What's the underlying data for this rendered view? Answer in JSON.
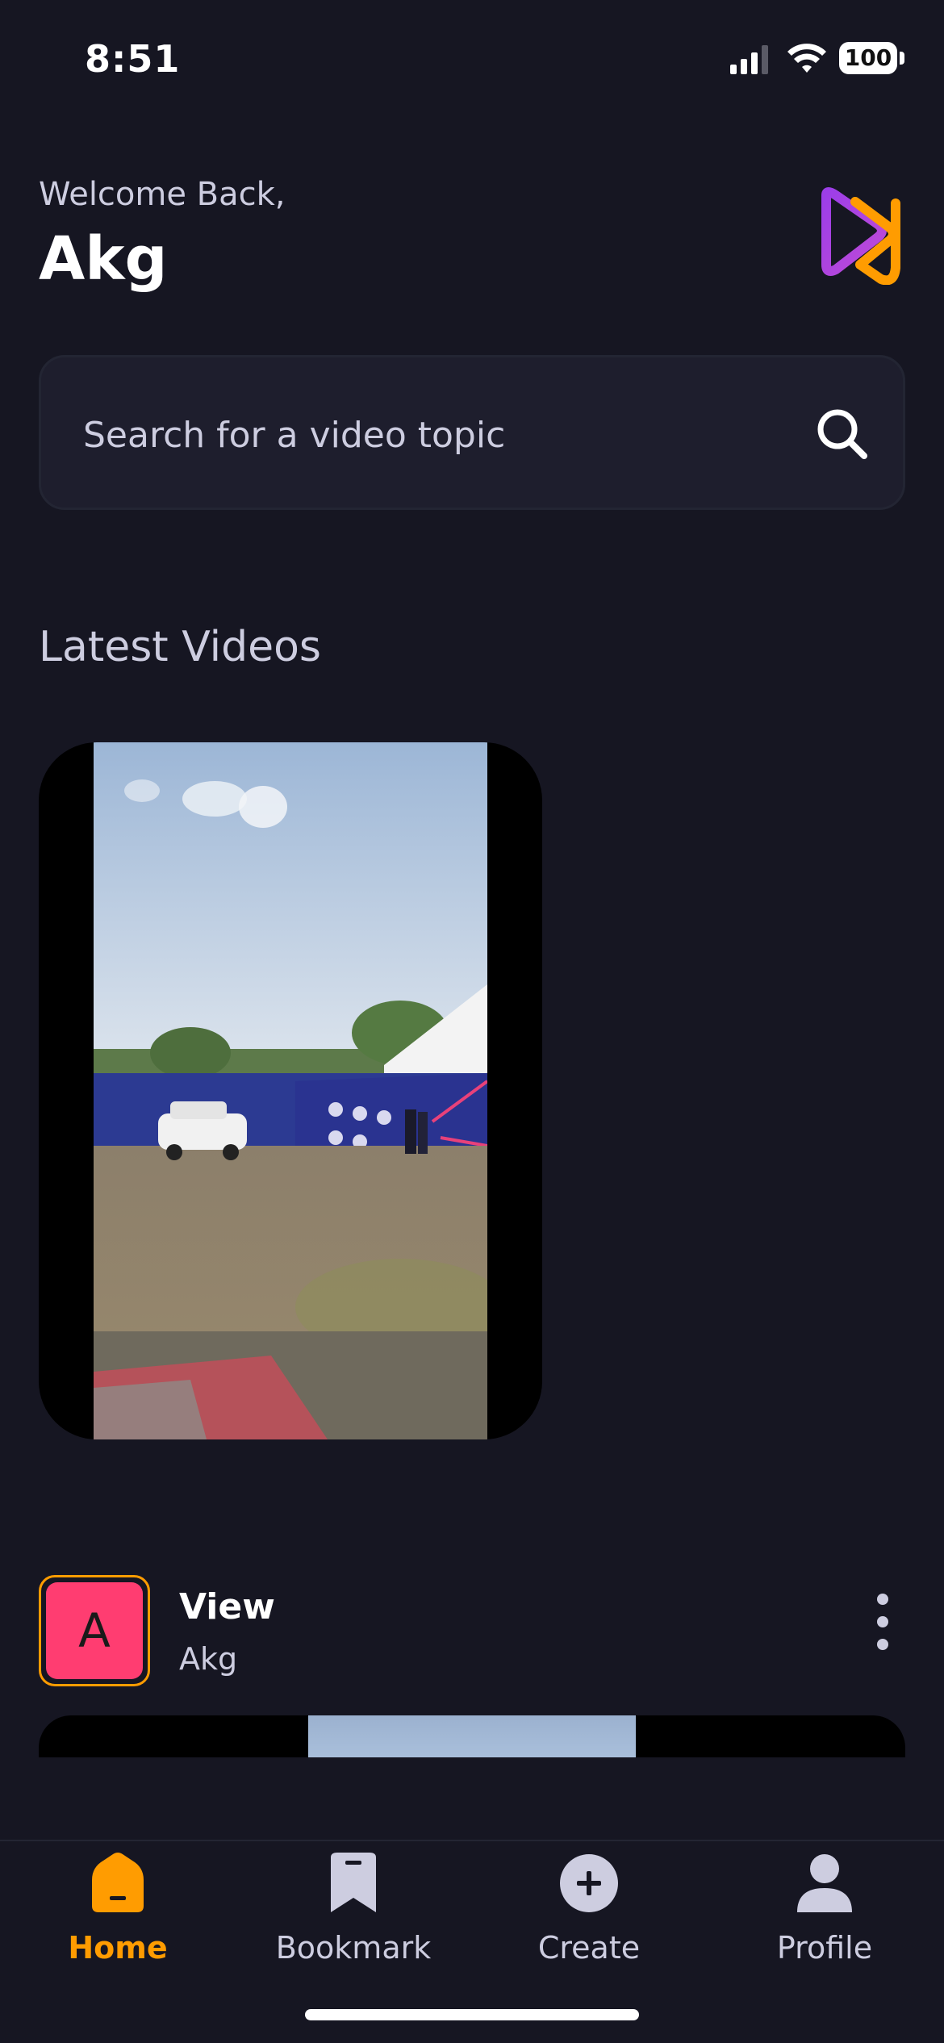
{
  "status_bar": {
    "time": "8:51",
    "battery": "100"
  },
  "header": {
    "welcome": "Welcome Back,",
    "username": "Akg"
  },
  "search": {
    "placeholder": "Search for a video topic"
  },
  "latest": {
    "title": "Latest Videos"
  },
  "post": {
    "avatar_letter": "A",
    "title": "View",
    "creator": "Akg"
  },
  "tabs": [
    {
      "label": "Home",
      "icon": "home-icon",
      "active": true
    },
    {
      "label": "Bookmark",
      "icon": "bookmark-icon",
      "active": false
    },
    {
      "label": "Create",
      "icon": "plus-icon",
      "active": false
    },
    {
      "label": "Profile",
      "icon": "profile-icon",
      "active": false
    }
  ],
  "colors": {
    "background": "#161622",
    "accent": "#ff9c01",
    "avatar": "#ff3d71",
    "surface": "#1e1e2d",
    "muted_text": "#cdcde0"
  }
}
